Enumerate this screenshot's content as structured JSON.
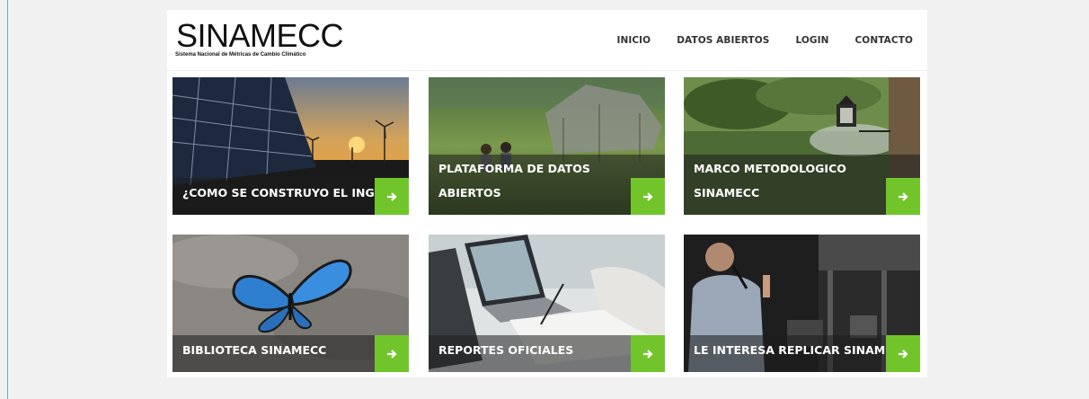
{
  "header": {
    "logo_title": "SINAMECC",
    "logo_subtitle": "Sistema Nacional de Métricas de Cambio Climático",
    "nav": [
      "INICIO",
      "DATOS ABIERTOS",
      "LOGIN",
      "CONTACTO"
    ]
  },
  "cards": [
    {
      "label": "¿COMO SE CONSTRUYO EL INGEI?",
      "image": "solar-panels-wind-turbines"
    },
    {
      "label": "PLATAFORMA DE DATOS ABIERTOS",
      "image": "children-field-hut"
    },
    {
      "label": "MARCO METODOLOGICO SINAMECC",
      "image": "street-lamp-forest"
    },
    {
      "label": "BIBLIOTECA SINAMECC",
      "image": "blue-butterfly"
    },
    {
      "label": "REPORTES OFICIALES",
      "image": "laptop-desk-writing"
    },
    {
      "label": "LE INTERESA REPLICAR SINAMECC",
      "image": "speaker-conference"
    }
  ],
  "colors": {
    "accent": "#71c52b",
    "page_bg": "#f1f1f1"
  },
  "icons": {
    "card_arrow": "arrow-right-icon"
  }
}
